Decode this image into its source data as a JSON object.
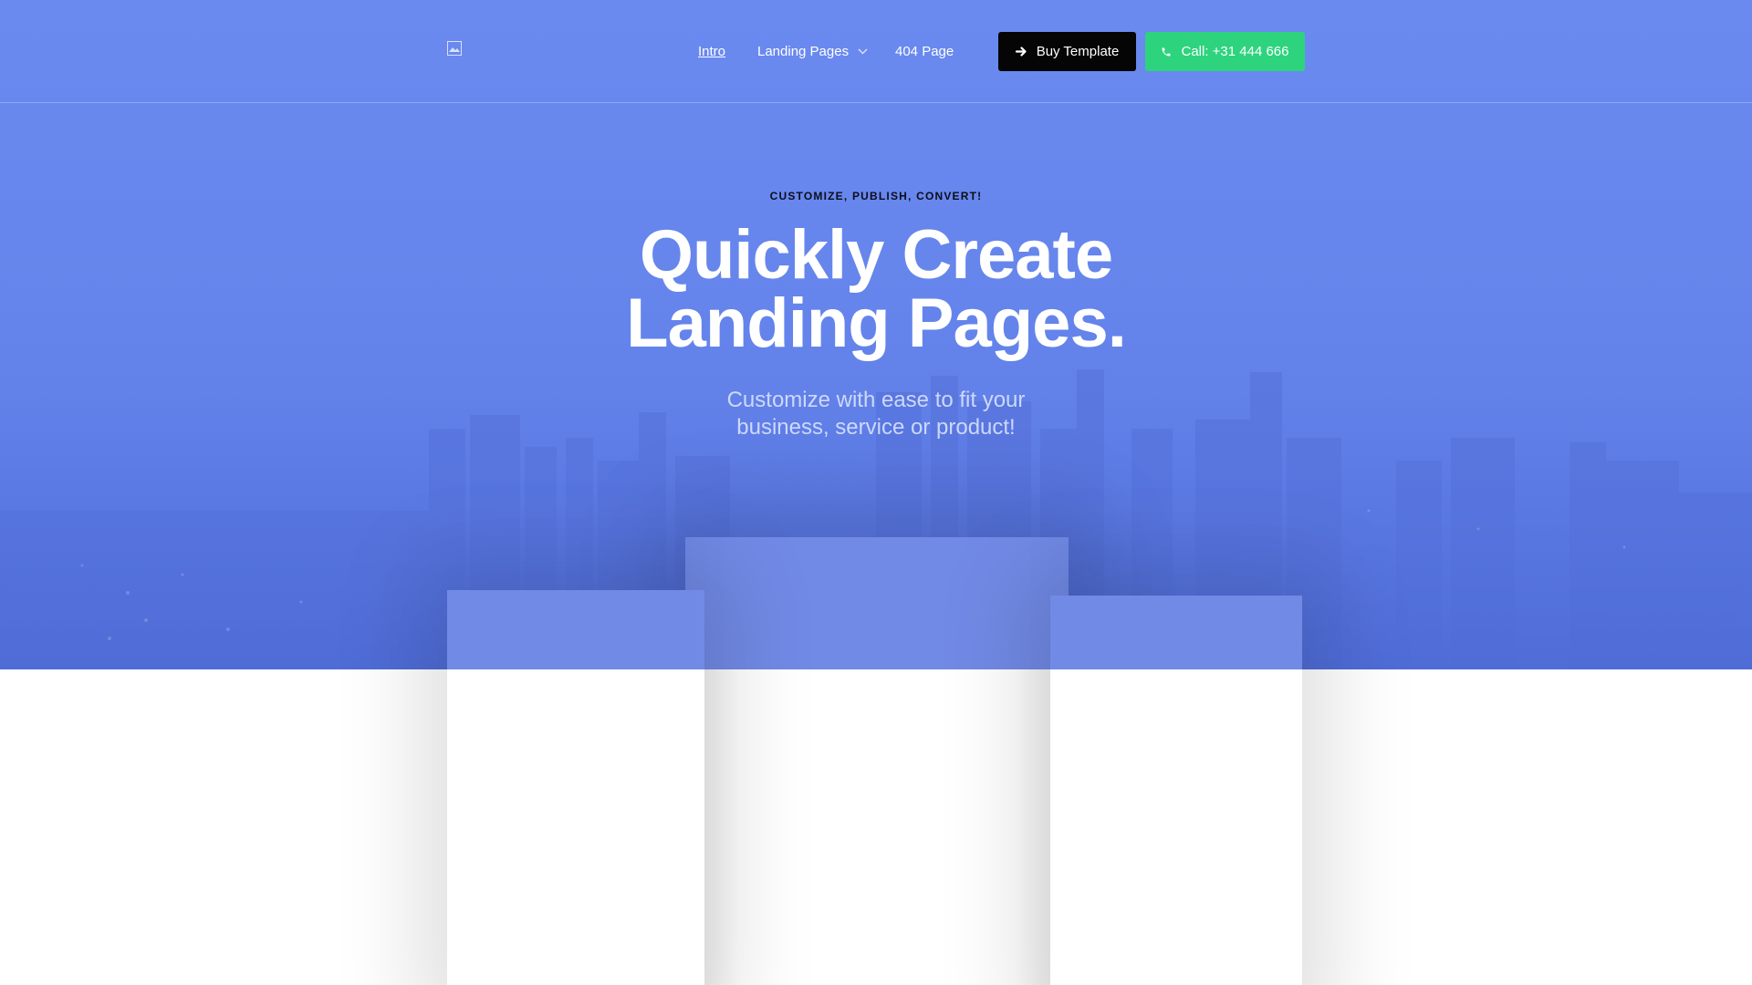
{
  "header": {
    "logo_alt": "Logo",
    "nav": [
      {
        "label": "Intro"
      },
      {
        "label": "Landing Pages"
      },
      {
        "label": "404 Page"
      }
    ],
    "buy_button": {
      "label": "Buy Template",
      "icon": "arrow-right-icon"
    },
    "call_button": {
      "label": "Call: +31 444 666",
      "icon": "phone-icon"
    }
  },
  "hero": {
    "eyebrow": "CUSTOMIZE, PUBLISH, CONVERT!",
    "headline_line1": "Quickly Create",
    "headline_line2": "Landing Pages.",
    "subhead_line1": "Customize with ease to fit your",
    "subhead_line2": "business, service or product!"
  },
  "colors": {
    "hero_background": "#6585ec",
    "buy_button": "#050505",
    "call_button": "#2ed37e",
    "text_white": "#ffffff"
  }
}
